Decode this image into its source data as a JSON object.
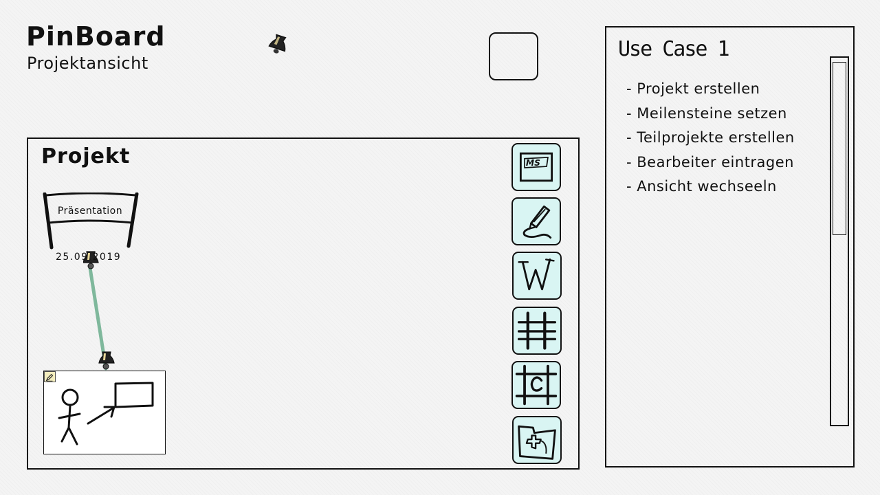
{
  "header": {
    "title": "PinBoard",
    "subtitle": "Projektansicht",
    "bell_icon": "bell-icon",
    "square_button": "blank-square-button"
  },
  "project": {
    "title": "Projekt",
    "milestone": {
      "label": "Präsentation",
      "date": "25.09.2019",
      "icon": "banner-icon"
    },
    "card": {
      "icons": [
        "edit-icon",
        "stick-figure-icon",
        "arrow-icon",
        "rectangle-icon"
      ]
    },
    "toolbar": [
      {
        "name": "milestone-tool",
        "icon": "ms-board-icon",
        "text": "MS"
      },
      {
        "name": "pen-tool",
        "icon": "pen-icon"
      },
      {
        "name": "text-tool",
        "icon": "w-letter-icon",
        "text": "W"
      },
      {
        "name": "grid-tool",
        "icon": "grid-icon"
      },
      {
        "name": "frame-tool",
        "icon": "frame-circle-icon"
      },
      {
        "name": "add-folder-tool",
        "icon": "folder-plus-icon"
      }
    ]
  },
  "usecase": {
    "title": "Use Case 1",
    "items": [
      "- Projekt erstellen",
      "- Meilensteine setzen",
      "- Teilprojekte erstellen",
      "- Bearbeiter eintragen",
      "- Ansicht wechseeln"
    ]
  },
  "colors": {
    "background": "#f4f4f4",
    "tool_fill": "#d9f5f3",
    "connector": "#7fb89c",
    "bell_body": "#222222",
    "bell_highlight": "#e9d89a"
  }
}
